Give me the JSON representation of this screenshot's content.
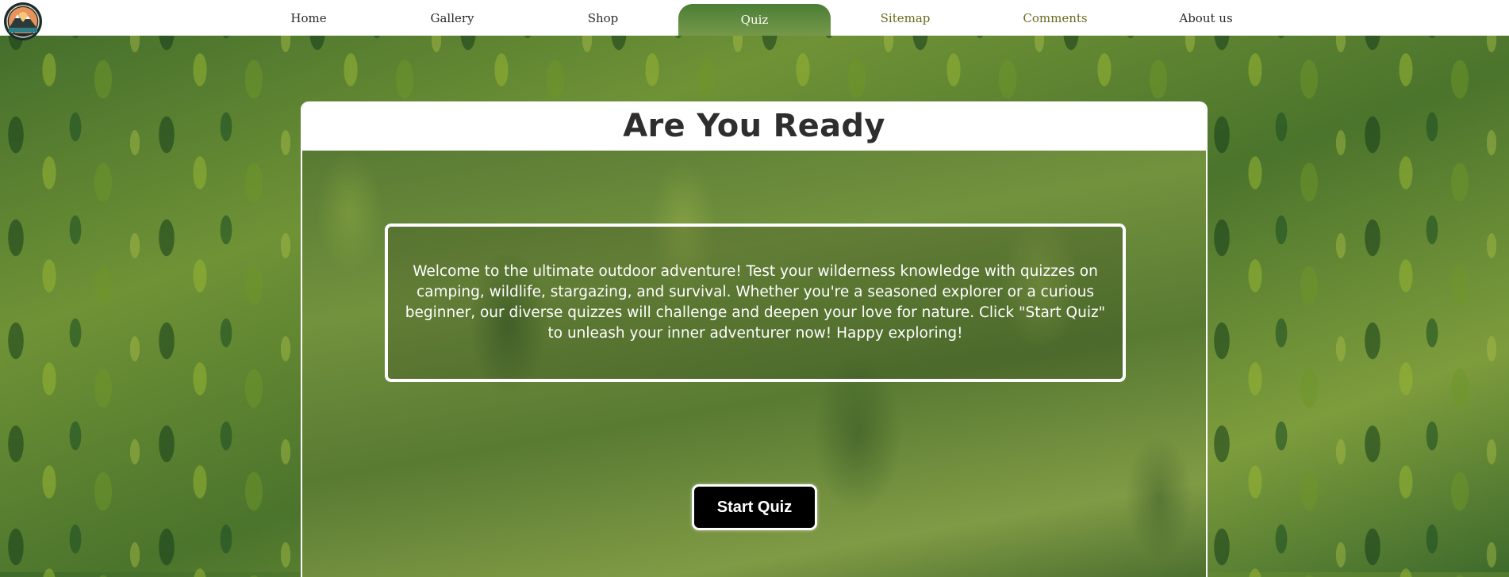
{
  "nav": {
    "items": [
      {
        "label": "Home"
      },
      {
        "label": "Gallery"
      },
      {
        "label": "Shop"
      },
      {
        "label": "Quiz",
        "active": true
      },
      {
        "label": "Sitemap"
      },
      {
        "label": "Comments"
      },
      {
        "label": "About us"
      }
    ]
  },
  "logo": {
    "icon": "mountain-logo-icon"
  },
  "card": {
    "title": "Are You Ready",
    "welcome_text": "Welcome to the ultimate outdoor adventure! Test your wilderness knowledge with quizzes on camping, wildlife, stargazing, and survival. Whether you're a seasoned explorer or a curious beginner, our diverse quizzes will challenge and deepen your love for nature. Click \"Start Quiz\" to unleash your inner adventurer now! Happy exploring!",
    "start_button": "Start Quiz"
  },
  "colors": {
    "nav_background": "#ffffff",
    "active_tab": "#5f8a3c",
    "button_background": "#000000",
    "forest_green": "#5e7f33"
  }
}
